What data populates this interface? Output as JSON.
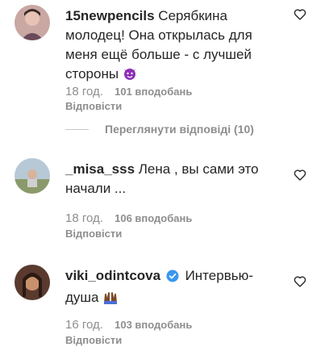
{
  "comments": [
    {
      "username": "15newpencils",
      "text": "Серябкина молодец! Она открылась для меня ещё больше - с лучшей стороны",
      "emoji": "devil-emoji",
      "time": "18 год.",
      "likes": "101 вподобань",
      "reply_label": "Відповісти",
      "view_replies": "Переглянути відповіді (10)"
    },
    {
      "username": "_misa_sss",
      "text": "Лена , вы сами это начали ...",
      "time": "18 год.",
      "likes": "106 вподобань",
      "reply_label": "Відповісти"
    },
    {
      "username": "viki_odintcova",
      "verified": true,
      "text": "Интервью-душа",
      "emoji": "raised-hands-emoji",
      "time": "16 год.",
      "likes": "103 вподобань",
      "reply_label": "Відповісти"
    }
  ],
  "colors": {
    "text": "#262626",
    "secondary": "#8e8e8e",
    "verified": "#3897f0",
    "divider": "#c7c7c7"
  },
  "icons": [
    "heart-outline-icon",
    "verified-badge-icon"
  ]
}
